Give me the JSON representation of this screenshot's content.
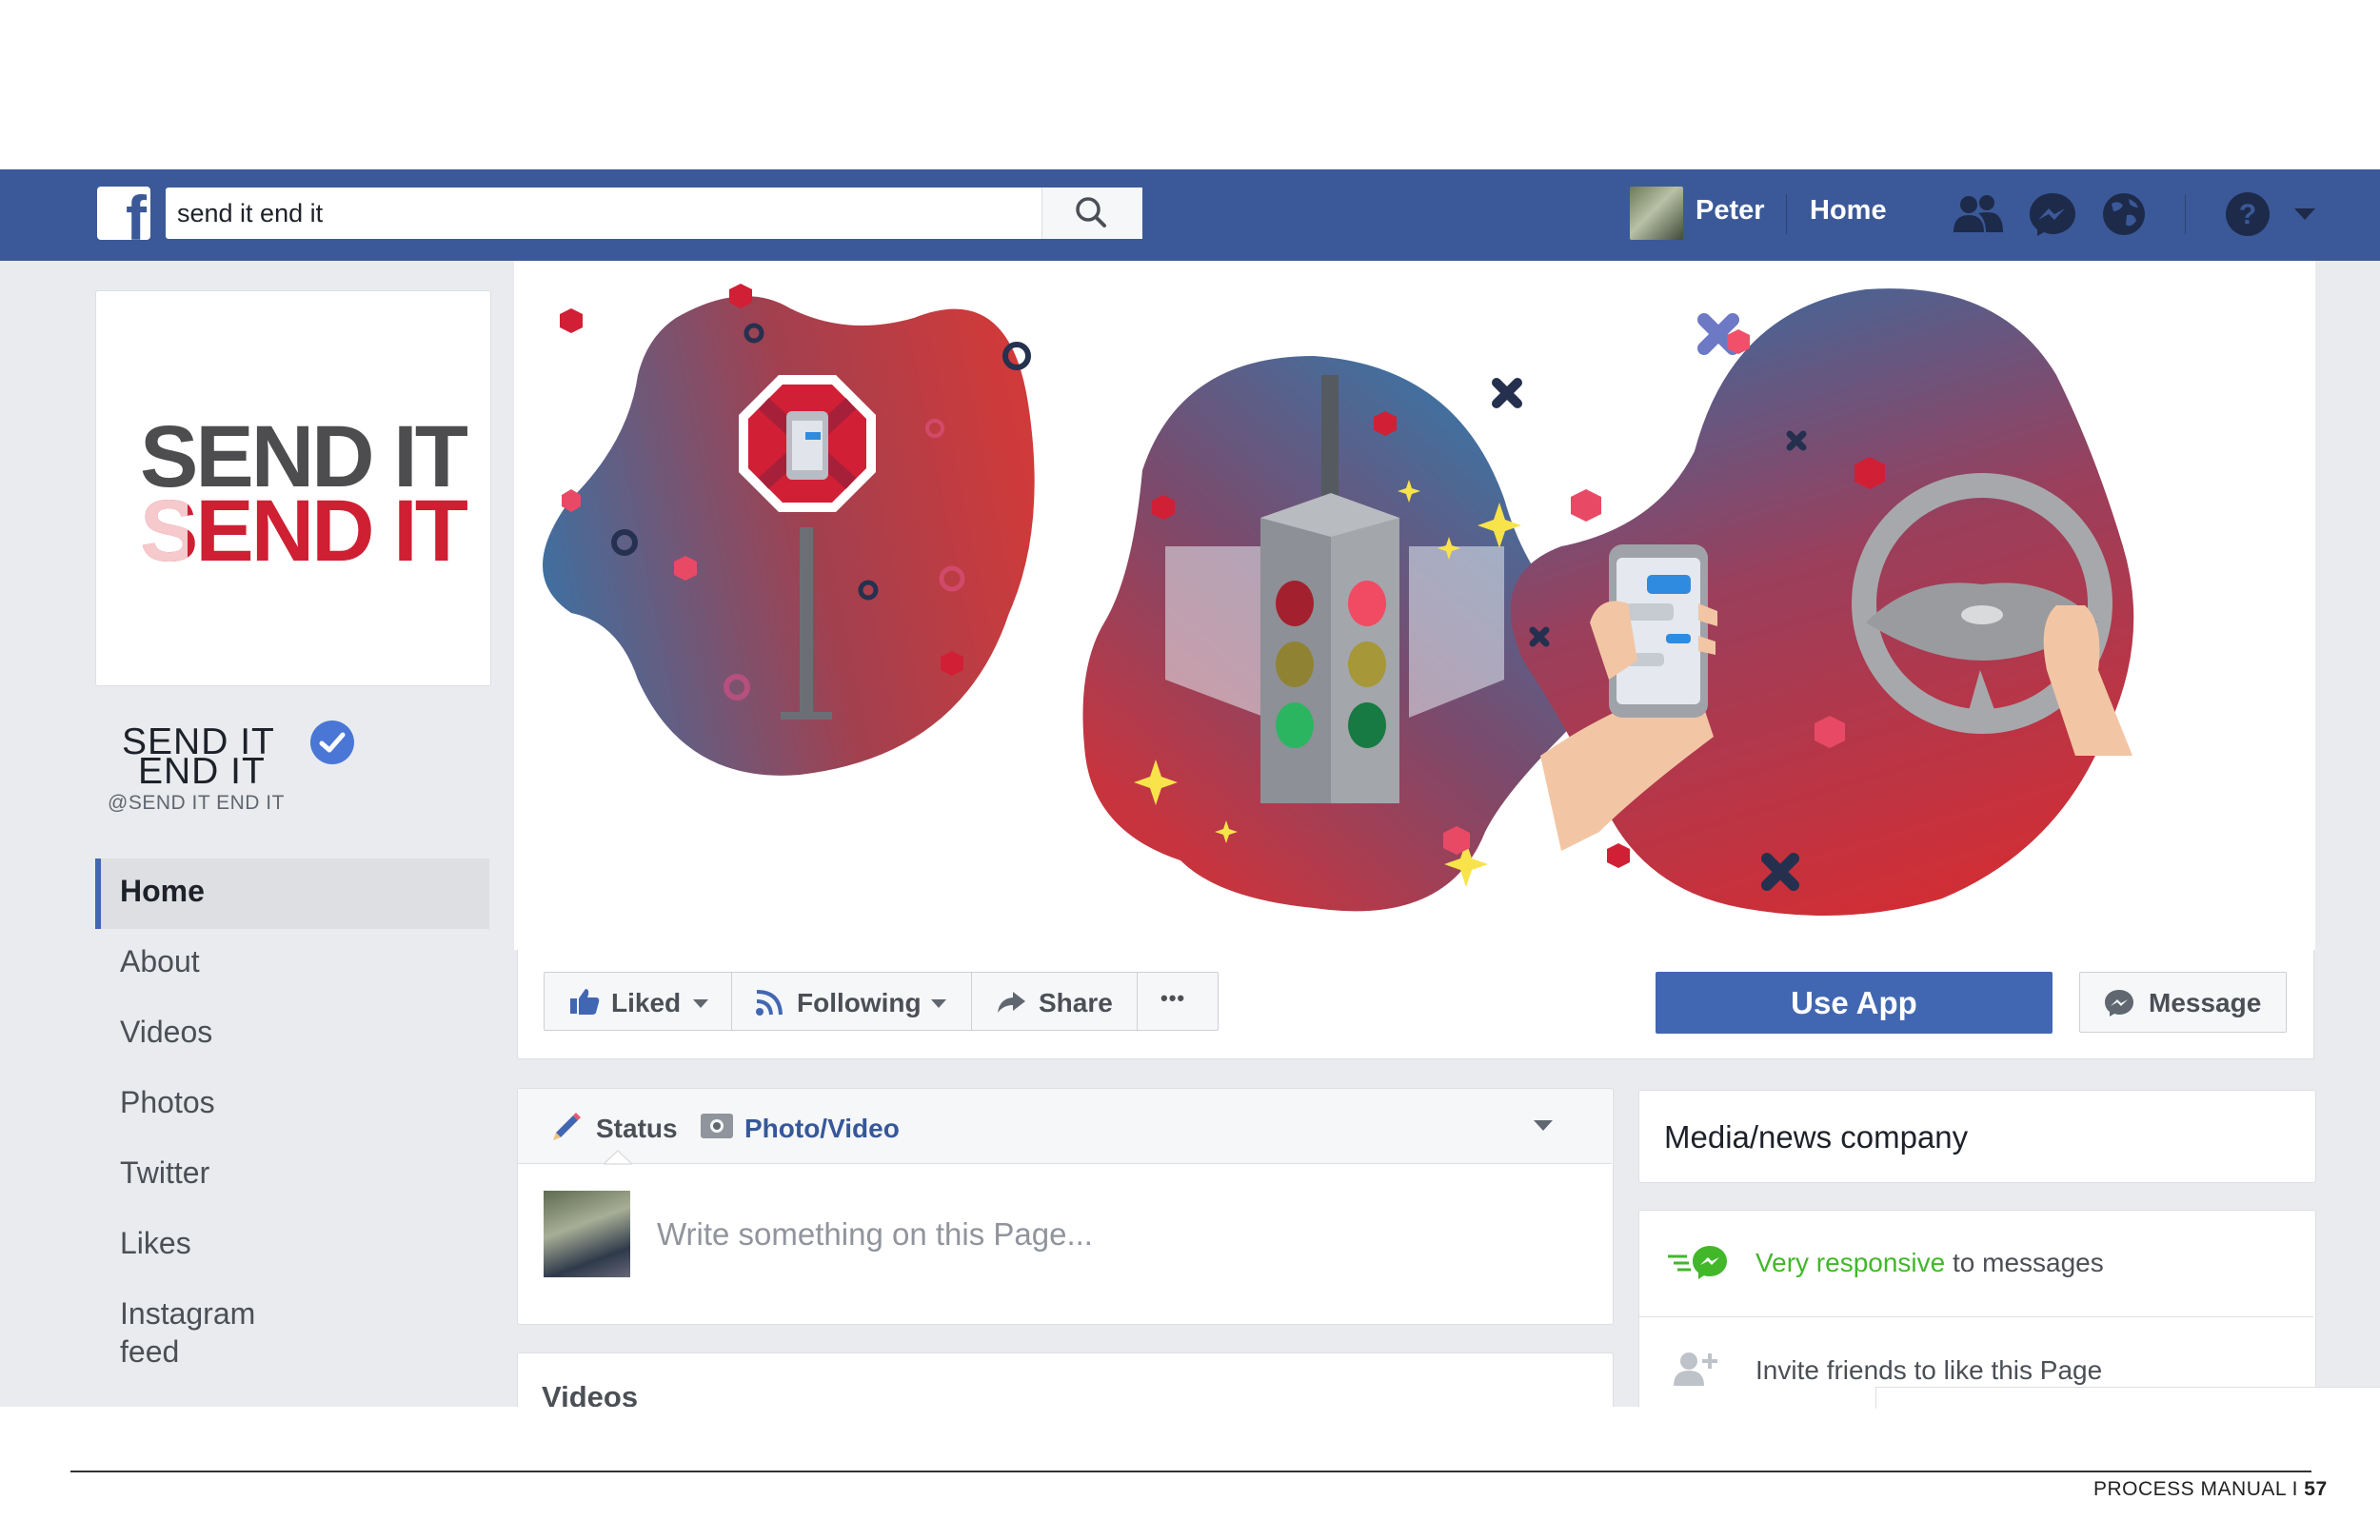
{
  "topbar": {
    "search_value": "send it end it",
    "user_name": "Peter",
    "home_label": "Home",
    "icons": [
      "facebook-f-icon",
      "search-icon",
      "friends-icon",
      "messenger-icon",
      "globe-icon",
      "help-icon",
      "caret-down-icon"
    ]
  },
  "profile": {
    "logo_line_1": "SEND IT",
    "logo_line_2": "SEND IT",
    "name_line_1": "SEND IT",
    "name_line_2": "END IT",
    "handle": "@SEND IT END IT",
    "logo_colors": {
      "dark": "#4d4d4f",
      "red": "#cf1f33",
      "faded": "#f6c9cc"
    }
  },
  "sidebar": {
    "items": [
      {
        "label": "Home",
        "active": true
      },
      {
        "label": "About"
      },
      {
        "label": "Videos"
      },
      {
        "label": "Photos"
      },
      {
        "label": "Twitter"
      },
      {
        "label": "Likes"
      },
      {
        "label": "Instagram",
        "label_2": "feed"
      }
    ]
  },
  "actions": {
    "liked": "Liked",
    "following": "Following",
    "share": "Share",
    "more": "•••",
    "use_app": "Use App",
    "message": "Message"
  },
  "composer": {
    "status_tab": "Status",
    "photo_tab": "Photo/Video",
    "placeholder": "Write something on this Page..."
  },
  "videos": {
    "title": "Videos"
  },
  "info": {
    "category": "Media/news company",
    "responsive_strong": "Very responsive",
    "responsive_rest": " to messages",
    "invite": "Invite friends to like this Page"
  },
  "footer": {
    "label": "PROCESS MANUAL I ",
    "page": "57"
  },
  "colors": {
    "fb_blue": "#3b5998",
    "button_blue": "#4267b2",
    "responsive_green": "#42b72a",
    "blob_blue": "#3f6fa0",
    "blob_red": "#c9343d"
  }
}
